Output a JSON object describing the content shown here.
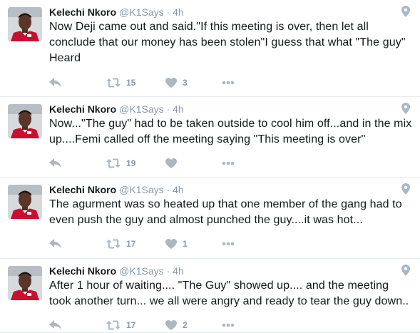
{
  "colors": {
    "icon": "#aab8c2",
    "meta": "#8899a6",
    "text": "#14171a",
    "divider": "#e6ecf0"
  },
  "icons": [
    "reply-icon",
    "retweet-icon",
    "heart-icon",
    "more-icon",
    "location-pin-icon"
  ],
  "tweets": [
    {
      "name": "Kelechi Nkoro",
      "handle": "@K1Says",
      "sep": "·",
      "time": "4h",
      "text": "Now Deji came out and said.\"If this meeting is over, then let all conclude that our money has been stolen\"I guess that what \"The guy\" Heard",
      "retweets": "15",
      "likes": "3"
    },
    {
      "name": "Kelechi Nkoro",
      "handle": "@K1Says",
      "sep": "·",
      "time": "4h",
      "text": "Now...\"The guy\" had to be taken outside to cool him off...and in the mix up....Femi called off the meeting saying \"This meeting is over\"",
      "retweets": "19",
      "likes": ""
    },
    {
      "name": "Kelechi Nkoro",
      "handle": "@K1Says",
      "sep": "·",
      "time": "4h",
      "text": "The agurment was so heated up that one member of the gang had to even push the guy and almost punched the guy....it was hot...",
      "retweets": "17",
      "likes": "1"
    },
    {
      "name": "Kelechi Nkoro",
      "handle": "@K1Says",
      "sep": "·",
      "time": "4h",
      "text": "After 1 hour of waiting.... \"The Guy\" showed up.... and the meeting took another turn... we all were angry and ready to tear the guy down..",
      "retweets": "17",
      "likes": "2"
    }
  ]
}
